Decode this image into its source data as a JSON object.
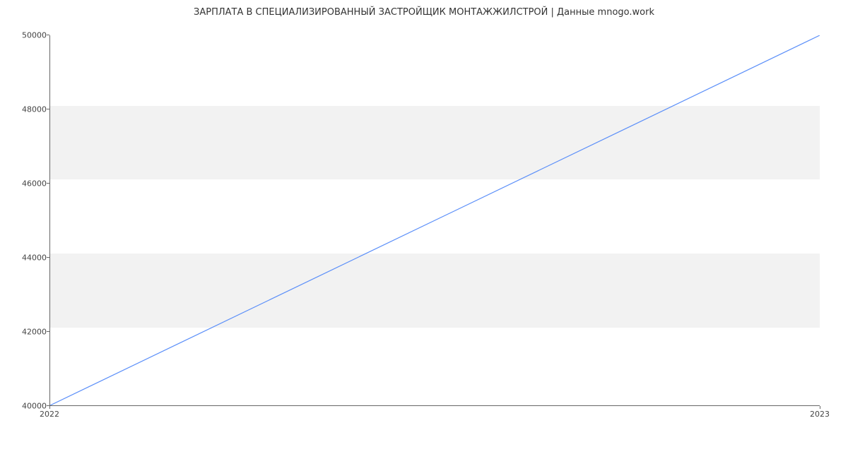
{
  "chart_data": {
    "type": "line",
    "title": "ЗАРПЛАТА В СПЕЦИАЛИЗИРОВАННЫЙ ЗАСТРОЙЩИК МОНТАЖЖИЛСТРОЙ | Данные mnogo.work",
    "x": [
      2022,
      2023
    ],
    "values": [
      40000,
      50000
    ],
    "xlabel": "",
    "ylabel": "",
    "ylim": [
      40000,
      50000
    ],
    "xlim": [
      2022,
      2023
    ],
    "y_ticks": [
      40000,
      42000,
      44000,
      46000,
      48000,
      50000
    ],
    "x_ticks": [
      2022,
      2023
    ],
    "line_color": "#5b8ff9",
    "bands": true
  }
}
